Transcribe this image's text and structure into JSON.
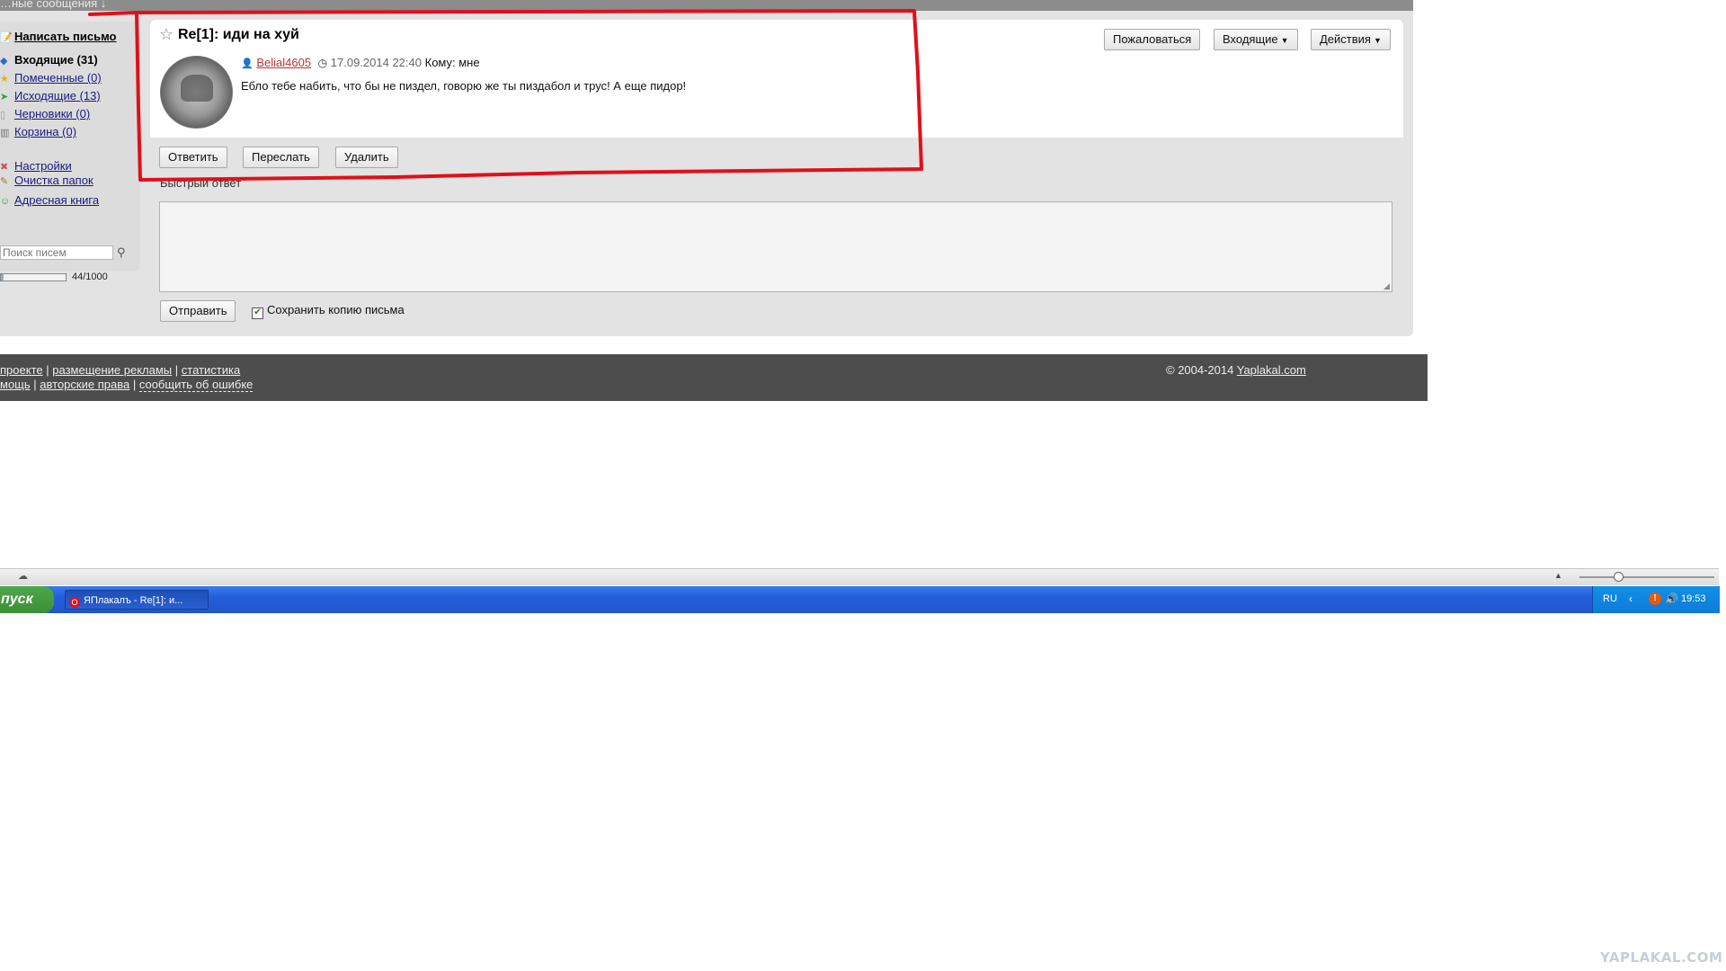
{
  "top": {
    "private_messages_label": "…ные сообщения ↓"
  },
  "sidebar": {
    "compose": "Написать письмо",
    "folders": [
      {
        "label": "Входящие (31)",
        "icon": "inbox-icon"
      },
      {
        "label": "Помеченные (0)",
        "icon": "star-folder-icon"
      },
      {
        "label": "Исходящие (13)",
        "icon": "sent-icon"
      },
      {
        "label": "Черновики (0)",
        "icon": "drafts-icon"
      },
      {
        "label": "Корзина (0)",
        "icon": "trash-icon"
      }
    ],
    "settings": "Настройки",
    "clean_folders": "Очистка папок",
    "address_book": "Адресная книга",
    "search_placeholder": "Поиск писем",
    "quota_text": "44/1000",
    "quota_fraction": 0.044
  },
  "message": {
    "subject": "Re[1]: иди на хуй",
    "author": "Belial4605",
    "date": "17.09.2014 22:40",
    "to": "Кому: мне",
    "body": "Ебло тебе набить, что бы не пиздел, говорю же ты пиздабол и трус! А еще пидор!"
  },
  "toolbar": {
    "complain": "Пожаловаться",
    "inbox": "Входящие",
    "actions": "Действия"
  },
  "actions": {
    "reply": "Ответить",
    "forward": "Переслать",
    "delete": "Удалить"
  },
  "quick_reply": {
    "label": "Быстрый ответ",
    "value": "",
    "send": "Отправить",
    "save_copy": "Сохранить копию письма",
    "save_copy_checked": true
  },
  "footer": {
    "line1": [
      "проекте",
      "размещение рекламы",
      "статистика"
    ],
    "line2": [
      "мощь",
      "авторские права",
      "сообщить об ошибке"
    ],
    "separator": "|",
    "copyright": "© 2004-2014",
    "site": "Yaplakal.com"
  },
  "taskbar": {
    "start": "пуск",
    "window": "ЯПлакалъ - Re[1]: и...",
    "lang": "RU",
    "time": "19:53"
  },
  "watermark": "YAPLAKAL.COM",
  "colors": {
    "annotation_red": "#e0101a",
    "author_link": "#b33333",
    "footer_bg": "#4d4d4d",
    "taskbar_blue": "#245edb",
    "start_green": "#3c8f36"
  }
}
